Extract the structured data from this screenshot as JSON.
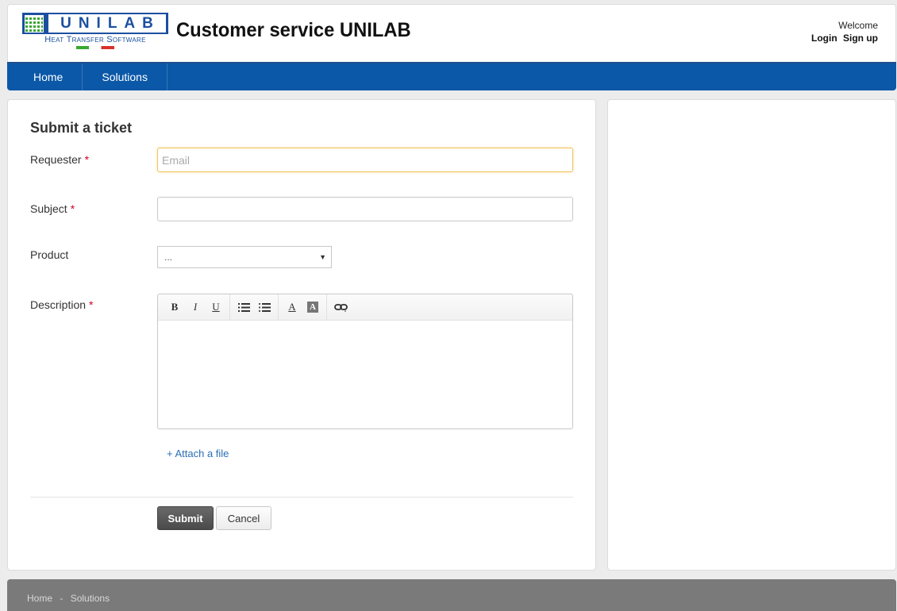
{
  "header": {
    "logo": {
      "word": "UNILAB",
      "subtitle": "Heat Transfer Software"
    },
    "title": "Customer service UNILAB",
    "welcome": "Welcome",
    "login_label": "Login",
    "signup_label": "Sign up"
  },
  "nav": {
    "items": [
      {
        "label": "Home"
      },
      {
        "label": "Solutions"
      }
    ]
  },
  "form": {
    "title": "Submit a ticket",
    "requester": {
      "label": "Requester",
      "required_mark": "*",
      "placeholder": "Email",
      "value": ""
    },
    "subject": {
      "label": "Subject",
      "required_mark": "*",
      "value": ""
    },
    "product": {
      "label": "Product",
      "selected": "...",
      "arrow": "▼"
    },
    "description": {
      "label": "Description",
      "required_mark": "*",
      "value": ""
    },
    "toolbar": {
      "bold": "B",
      "italic": "I",
      "underline": "U",
      "font_color": "A",
      "bg_color": "A"
    },
    "attach_label": "+ Attach a file",
    "submit_label": "Submit",
    "cancel_label": "Cancel"
  },
  "footer": {
    "breadcrumb": [
      "Home",
      "-",
      "Solutions"
    ]
  }
}
